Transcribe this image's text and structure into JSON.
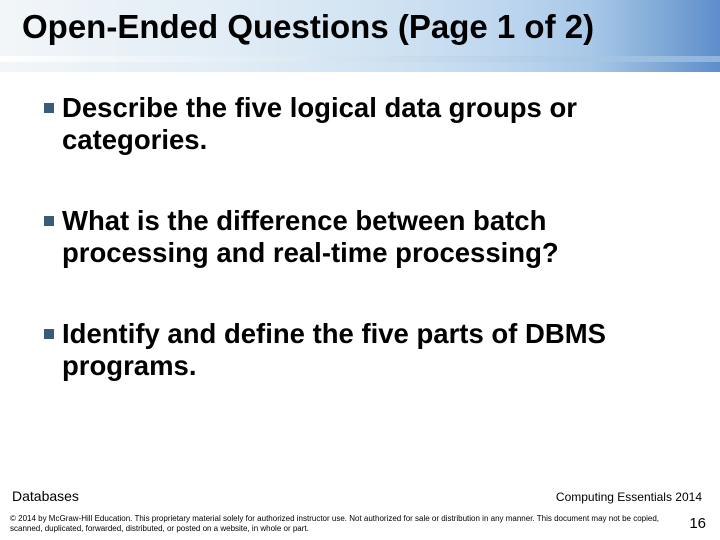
{
  "title": "Open-Ended Questions (Page 1 of 2)",
  "questions": [
    "Describe the five logical data groups or categories.",
    "What is the difference between batch processing and real-time processing?",
    "Identify and define the five parts of DBMS programs."
  ],
  "footer": {
    "left": "Databases",
    "right": "Computing Essentials 2014",
    "copyright": "© 2014 by McGraw-Hill Education. This proprietary material solely for authorized instructor use. Not authorized for sale or distribution in any manner. This document may not be copied, scanned, duplicated, forwarded, distributed, or posted on a website, in whole or part.",
    "page_number": "16"
  }
}
